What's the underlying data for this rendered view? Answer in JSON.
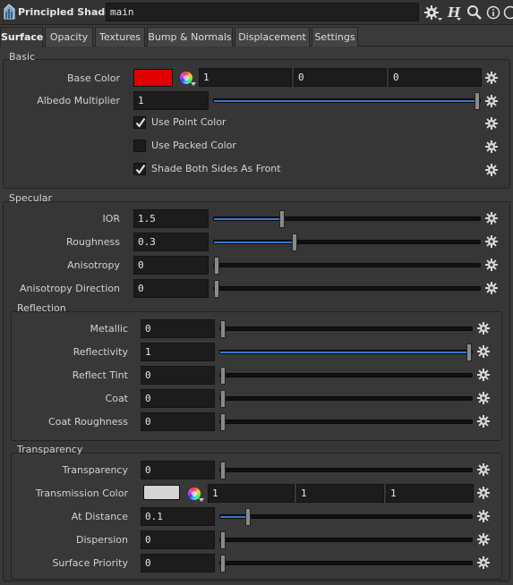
{
  "header": {
    "node_type": "Principled Shader",
    "node_name": "main",
    "icons": [
      "node-type-icon",
      "gear-menu-icon",
      "help-h-icon",
      "search-icon",
      "info-icon",
      "help-question-icon"
    ]
  },
  "tabs": [
    "Surface",
    "Opacity",
    "Textures",
    "Bump & Normals",
    "Displacement",
    "Settings"
  ],
  "active_tab": "Surface",
  "basic": {
    "title": "Basic",
    "base_color": {
      "label": "Base Color",
      "swatch": "#e00000",
      "r": "1",
      "g": "0",
      "b": "0"
    },
    "albedo": {
      "label": "Albedo Multiplier",
      "value": "1",
      "level": 1.0
    },
    "use_point_color": {
      "label": "Use Point Color",
      "checked": true
    },
    "use_packed_color": {
      "label": "Use Packed Color",
      "checked": false
    },
    "shade_both_sides": {
      "label": "Shade Both Sides As Front",
      "checked": true
    }
  },
  "specular": {
    "title": "Specular",
    "ior": {
      "label": "IOR",
      "value": "1.5",
      "level": 0.25
    },
    "roughness": {
      "label": "Roughness",
      "value": "0.3",
      "level": 0.3
    },
    "anisotropy": {
      "label": "Anisotropy",
      "value": "0",
      "level": 0
    },
    "anisotropy_direction": {
      "label": "Anisotropy Direction",
      "value": "0",
      "level": 0
    }
  },
  "reflection": {
    "title": "Reflection",
    "metallic": {
      "label": "Metallic",
      "value": "0",
      "level": 0
    },
    "reflectivity": {
      "label": "Reflectivity",
      "value": "1",
      "level": 1
    },
    "reflect_tint": {
      "label": "Reflect Tint",
      "value": "0",
      "level": 0
    },
    "coat": {
      "label": "Coat",
      "value": "0",
      "level": 0
    },
    "coat_roughness": {
      "label": "Coat Roughness",
      "value": "0",
      "level": 0
    }
  },
  "transparency": {
    "title": "Transparency",
    "transparency": {
      "label": "Transparency",
      "value": "0",
      "level": 0
    },
    "transmission_color": {
      "label": "Transmission Color",
      "swatch": "#d4d4d4",
      "r": "1",
      "g": "1",
      "b": "1"
    },
    "at_distance": {
      "label": "At Distance",
      "value": "0.1",
      "level": 0.1
    },
    "dispersion": {
      "label": "Dispersion",
      "value": "0",
      "level": 0
    },
    "surface_priority": {
      "label": "Surface Priority",
      "value": "0",
      "level": 0
    }
  },
  "colors": {
    "accent": "#3a78c9",
    "background": "#3a3a3a",
    "field": "#1c1c1c"
  }
}
